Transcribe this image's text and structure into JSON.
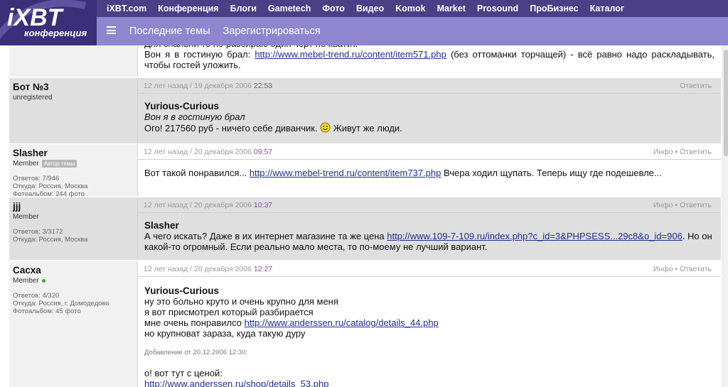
{
  "logo": {
    "brand": "iXBT",
    "sub": "конференция"
  },
  "topnav": [
    "iXBT.com",
    "Конференция",
    "Блоги",
    "Gametech",
    "Фото",
    "Видео",
    "Komok",
    "Market",
    "Prosound",
    "ПроБизнес",
    "Каталог"
  ],
  "subnav": {
    "latest": "Последние темы",
    "register": "Зарегистрироваться"
  },
  "colors": {
    "topbar": "#4b3f86",
    "subbar": "#8f86cf",
    "link": "#1f2d8f",
    "time": "#7a4fa0"
  },
  "posts": [
    {
      "cut_line": "Для спальни то не разбираю один черт не хватит.",
      "text_before": "Вон я в гостиную брал: ",
      "link": "http://www.mebel-trend.ru/content/item571.php",
      "text_after": " (без оттоманки торчащей) - всё равно надо раскладывать, чтобы гостей уложить."
    },
    {
      "author": "Бот №3",
      "role": "unregistered",
      "ago": "12 лет назад",
      "date": "19 декабря 2006",
      "time": "22:53",
      "actions": "Ответить",
      "quote_author": "Yurious-Curious",
      "quote_text": "Вон я в гостиную брал",
      "text_before": "Ого! 217560 руб - ничего себе диванчик. ",
      "smiley": "smiley-icon",
      "text_after": " Живут же люди."
    },
    {
      "author": "Slasher",
      "role": "Member",
      "badge": "Автор темы",
      "stats": [
        "Ответов: 7/946",
        "Откуда: Россия, Москва",
        "Фотоальбом: 244 фото"
      ],
      "ago": "12 лет назад",
      "date": "20 декабря 2006",
      "time": "09:57",
      "actions": "Инфо • Ответить",
      "text_before": "Вот такой понравился... ",
      "link": "http://www.mebel-trend.ru/content/item737.php",
      "text_after": " Вчера ходил щупать. Теперь ищу где подешевле..."
    },
    {
      "author": "jjj",
      "role": "Member",
      "stats": [
        "Ответов: 3/3172",
        "Откуда: Россия, Москва"
      ],
      "ago": "12 лет назад",
      "date": "20 декабря 2006",
      "time": "10:37",
      "actions": "Инфо • Ответить",
      "quote_author": "Slasher",
      "text_before": "А чего искать? Даже в их интернет магазине та же цена ",
      "link": "http://www.109-7-109.ru/index.php?c_id=3&PHPSESS...29c8&o_id=906",
      "text_after": ". Но он какой-то огромный. Если реально мало места, то по-моему не лучший вариант."
    },
    {
      "author": "Сасха",
      "role": "Member",
      "stats": [
        "Ответов: 4/320",
        "Откуда: Россия, г. Домодедово",
        "Фотоальбом: 45 фото"
      ],
      "ago": "12 лет назад",
      "date": "20 декабря 2006",
      "time": "12:27",
      "actions": "Инфо • Ответить",
      "quote_author": "Yurious-Curious",
      "line1": "ну это больно круто и очень крупно для меня",
      "line2": "я вот присмотрел который разбирается",
      "line3_before": "мне очень понравилсо ",
      "line3_link": "http://www.anderssen.ru/catalog/details_44.php",
      "line4": "но крупноват зараза, куда такую дуру",
      "edit_note": "Добавление от 20.12.2006 12:30:",
      "line5": "о! вот тут с ценой:",
      "line6_link": "http://www.anderssen.ru/shop/details_53.php"
    }
  ]
}
